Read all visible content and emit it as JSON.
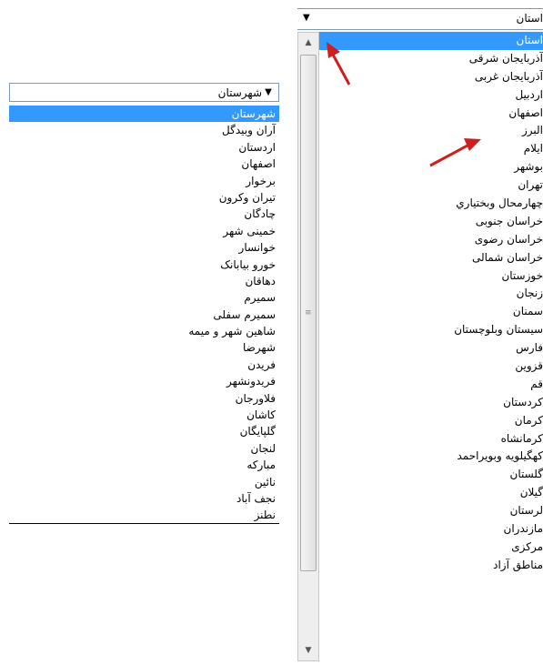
{
  "county_dropdown": {
    "selected": "شهرستان",
    "options": [
      "شهرستان",
      "آران وبیدگل",
      "اردستان",
      "اصفهان",
      "برخوار",
      "تیران وکرون",
      "چادگان",
      "خمینی شهر",
      "خوانسار",
      "خورو بیابانک",
      "دهاقان",
      "سمیرم",
      "سمیرم سفلی",
      "شاهین شهر و میمه",
      "شهرضا",
      "فریدن",
      "فریدونشهر",
      "فلاورجان",
      "کاشان",
      "گلپایگان",
      "لنجان",
      "مبارکه",
      "نائین",
      "نجف آباد",
      "نطنز"
    ]
  },
  "province_dropdown": {
    "selected": "استان",
    "options": [
      "استان",
      "آذربایجان شرقی",
      "آذربایجان غربی",
      "اردبیل",
      "اصفهان",
      "البرز",
      "ایلام",
      "بوشهر",
      "تهران",
      "چهارمحال وبختیاري",
      "خراسان جنوبی",
      "خراسان رضوی",
      "خراسان شمالی",
      "خوزستان",
      "زنجان",
      "سمنان",
      "سیستان وبلوچستان",
      "فارس",
      "قزوین",
      "قم",
      "کردستان",
      "کرمان",
      "کرمانشاه",
      "کهگیلویه وبویراحمد",
      "گلستان",
      "گیلان",
      "لرستان",
      "مازندران",
      "مرکزی",
      "مناطق آزاد"
    ]
  },
  "icons": {
    "dropdown_arrow": "▼",
    "scroll_up": "▲",
    "scroll_down": "▼",
    "grip": "≡"
  },
  "colors": {
    "highlight": "#3399ff",
    "annotation_arrow": "#cc1f1f"
  }
}
